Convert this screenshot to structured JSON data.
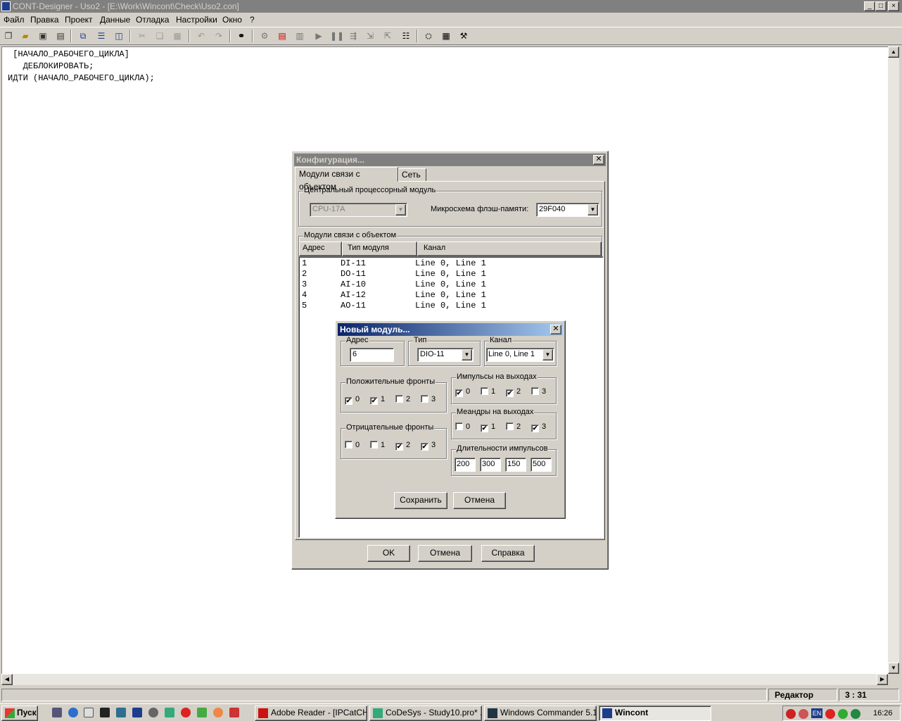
{
  "window": {
    "title": "CONT-Designer - Uso2 - [E:\\Work\\Wincont\\Check\\Uso2.con]",
    "min": "_",
    "max": "□",
    "close": "×"
  },
  "menu": [
    {
      "label": "Файл"
    },
    {
      "label": "Правка"
    },
    {
      "label": "Проект"
    },
    {
      "label": "Данные"
    },
    {
      "label": "Отладка"
    },
    {
      "label": "Настройки"
    },
    {
      "label": "Окно"
    },
    {
      "label": "?"
    }
  ],
  "editor": {
    "lines": [
      " [НАЧАЛО_РАБОЧЕГО_ЦИКЛА]",
      "   ДЕБЛОКИРОВАТЬ;",
      "ИДТИ (НАЧАЛО_РАБОЧЕГО_ЦИКЛА);"
    ]
  },
  "config_dialog": {
    "title": "Конфигурация...",
    "tabs": [
      "Модули связи с объектом",
      "Сеть"
    ],
    "cpu_group": "Центральный процессорный модуль",
    "cpu_value": "CPU-17A",
    "flash_label": "Микросхема флэш-памяти:",
    "flash_value": "29F040",
    "modules_group": "Модули связи с объектом",
    "columns": [
      "Адрес",
      "Тип модуля",
      "Канал"
    ],
    "rows": [
      {
        "addr": "1",
        "type": "DI-11",
        "channel": "Line 0, Line 1"
      },
      {
        "addr": "2",
        "type": "DO-11",
        "channel": "Line 0, Line 1"
      },
      {
        "addr": "3",
        "type": "AI-10",
        "channel": "Line 0, Line 1"
      },
      {
        "addr": "4",
        "type": "AI-12",
        "channel": "Line 0, Line 1"
      },
      {
        "addr": "5",
        "type": "AO-11",
        "channel": "Line 0, Line 1"
      }
    ],
    "ok": "OK",
    "cancel": "Отмена",
    "help": "Справка"
  },
  "new_module_dialog": {
    "title": "Новый модуль...",
    "addr_label": "Адрес",
    "addr_value": "6",
    "type_label": "Тип",
    "type_value": "DIO-11",
    "channel_label": "Канал",
    "channel_value": "Line 0, Line 1",
    "pos_fronts_label": "Положительные фронты",
    "neg_fronts_label": "Отрицательные фронты",
    "impulses_label": "Импульсы на выходах",
    "meanders_label": "Меандры на выходах",
    "durations_label": "Длительности импульсов",
    "bit_labels": [
      "0",
      "1",
      "2",
      "3"
    ],
    "pos_fronts": [
      true,
      true,
      false,
      false
    ],
    "neg_fronts": [
      false,
      false,
      true,
      true
    ],
    "impulses": [
      true,
      false,
      true,
      false
    ],
    "meanders": [
      false,
      true,
      false,
      true
    ],
    "durations": [
      "200",
      "300",
      "150",
      "500"
    ],
    "save": "Сохранить",
    "cancel": "Отмена"
  },
  "statusbar": {
    "mode": "Редактор",
    "position": "3 : 31"
  },
  "taskbar": {
    "start": "Пуск",
    "tasks": [
      {
        "label": "Adobe Reader - [IPCatCH..."
      },
      {
        "label": "CoDeSys - Study10.pro* ..."
      },
      {
        "label": "Windows Commander 5.1..."
      },
      {
        "label": "Wincont"
      }
    ],
    "lang": "EN",
    "clock": "16:26"
  }
}
